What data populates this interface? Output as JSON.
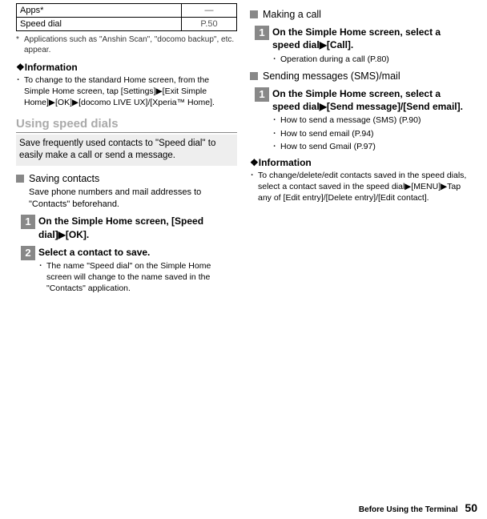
{
  "table": {
    "row1": {
      "label": "Apps*",
      "ref": "―"
    },
    "row2": {
      "label": "Speed dial",
      "ref": "P.50"
    }
  },
  "footnote": {
    "marker": "*",
    "text": "Applications such as \"Anshin Scan\", \"docomo backup\", etc. appear."
  },
  "info1": {
    "title": "❖Information",
    "bullet_marker": "･",
    "bullet_text": "To change to the standard Home screen, from the Simple Home screen, tap [Settings]▶[Exit Simple Home]▶[OK]▶[docomo LIVE UX]/[Xperia™ Home]."
  },
  "using": {
    "heading": "Using speed dials",
    "desc": "Save frequently used contacts to \"Speed dial\" to easily make a call or send a message."
  },
  "saving": {
    "heading": "Saving contacts",
    "desc": "Save phone numbers and mail addresses to \"Contacts\" beforehand."
  },
  "step1": {
    "num": "1",
    "title": "On the Simple Home screen, [Speed dial]▶[OK]."
  },
  "step2": {
    "num": "2",
    "title": "Select a contact to save.",
    "sub_marker": "･",
    "sub_text": "The name \"Speed dial\" on the Simple Home screen will change to the name saved in the \"Contacts\" application."
  },
  "making": {
    "heading": "Making a call"
  },
  "step_call": {
    "num": "1",
    "title": "On the Simple Home screen, select a speed dial▶[Call].",
    "sub_marker": "･",
    "sub_text": "Operation during a call (P.80)"
  },
  "sending": {
    "heading": "Sending messages (SMS)/mail"
  },
  "step_send": {
    "num": "1",
    "title": "On the Simple Home screen, select a speed dial▶[Send message]/[Send email].",
    "sub_marker": "･",
    "sub1": "How to send a message (SMS) (P.90)",
    "sub2": "How to send email (P.94)",
    "sub3": "How to send Gmail (P.97)"
  },
  "info2": {
    "title": "❖Information",
    "bullet_marker": "･",
    "bullet_text": "To change/delete/edit contacts saved in the speed dials, select a contact saved in the speed dial▶[MENU]▶Tap any of [Edit entry]/[Delete entry]/[Edit contact]."
  },
  "footer": {
    "text": "Before Using the Terminal",
    "page": "50"
  }
}
